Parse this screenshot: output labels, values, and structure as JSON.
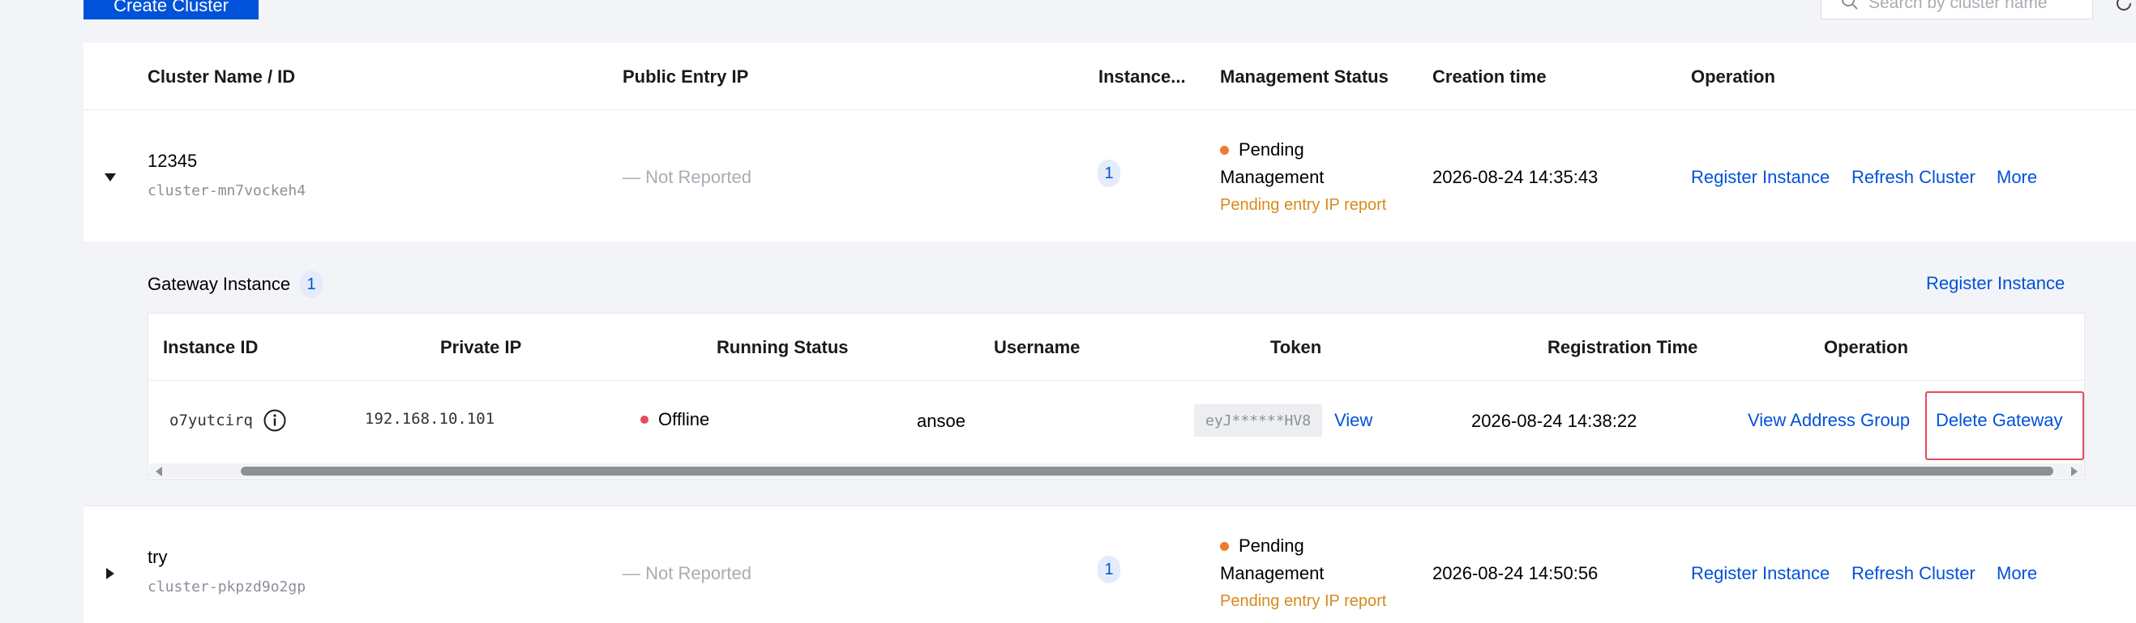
{
  "toolbar": {
    "create_label": "Create Cluster",
    "search_placeholder": "Search by cluster name"
  },
  "table": {
    "headers": {
      "name": "Cluster Name / ID",
      "ip": "Public Entry IP",
      "instances": "Instance...",
      "status": "Management Status",
      "created": "Creation time",
      "operation": "Operation"
    },
    "rows": [
      {
        "name": "12345",
        "id": "cluster-mn7vockeh4",
        "ip": "— Not Reported",
        "instances": "1",
        "status_line1": "Pending",
        "status_line2": "Management",
        "status_note": "Pending entry IP report",
        "created": "2026-08-24 14:35:43",
        "op_register": "Register Instance",
        "op_refresh": "Refresh Cluster",
        "op_more": "More"
      },
      {
        "name": "try",
        "id": "cluster-pkpzd9o2gp",
        "ip": "— Not Reported",
        "instances": "1",
        "status_line1": "Pending",
        "status_line2": "Management",
        "status_note": "Pending entry IP report",
        "created": "2026-08-24 14:50:56",
        "op_register": "Register Instance",
        "op_refresh": "Refresh Cluster",
        "op_more": "More"
      }
    ]
  },
  "gateway": {
    "title": "Gateway Instance",
    "count": "1",
    "register_label": "Register Instance",
    "headers": {
      "id": "Instance ID",
      "private_ip": "Private IP",
      "running": "Running Status",
      "username": "Username",
      "token": "Token",
      "reg_time": "Registration Time",
      "operation": "Operation"
    },
    "row": {
      "id": "o7yutcirq",
      "private_ip": "192.168.10.101",
      "running": "Offline",
      "username": "ansoe",
      "token": "eyJ******HV8",
      "view": "View",
      "reg_time": "2026-08-24 14:38:22",
      "view_group": "View Address Group",
      "delete": "Delete Gateway"
    }
  },
  "colors": {
    "primary": "#0052d9",
    "pending": "#ed7b2f",
    "offline": "#e34d59",
    "highlight": "#e34d59"
  }
}
